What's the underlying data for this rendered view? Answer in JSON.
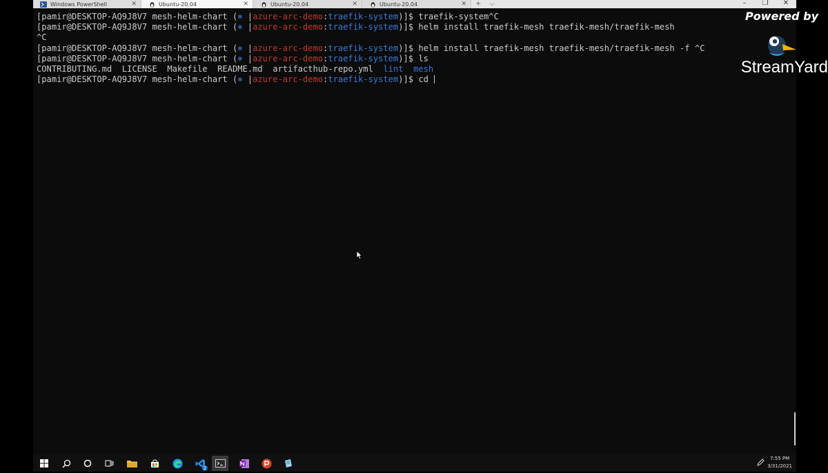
{
  "tabs": [
    {
      "label": "Windows PowerShell",
      "icon": "powershell-icon",
      "active": false
    },
    {
      "label": "Ubuntu-20.04",
      "icon": "linux-icon",
      "active": true
    },
    {
      "label": "Ubuntu-20.04",
      "icon": "linux-icon",
      "active": false
    },
    {
      "label": "Ubuntu-20.04",
      "icon": "linux-icon",
      "active": false
    }
  ],
  "tab_controls": {
    "add": "+",
    "dropdown": "⌵",
    "close": "✕"
  },
  "window_controls": {
    "minimize": "–",
    "maximize": "❐",
    "close": "✕"
  },
  "terminal": {
    "prompt": {
      "user_host": "[pamir@DESKTOP-AQ9J8V7 mesh-helm-chart (",
      "k8s_glyph": "⎈",
      "sep": " |",
      "cluster": "azure-arc-demo",
      "colon": ":",
      "namespace": "traefik-system",
      "end": ")]$ "
    },
    "lines": [
      {
        "type": "prompt",
        "cmd": "traefik-system^C"
      },
      {
        "type": "prompt",
        "cmd": "helm install traefik-mesh traefik-mesh/traefik-mesh"
      },
      {
        "type": "out",
        "text": "^C"
      },
      {
        "type": "prompt",
        "cmd": "helm install traefik-mesh traefik-mesh/traefik-mesh -f ^C"
      },
      {
        "type": "prompt",
        "cmd": "ls"
      },
      {
        "type": "ls",
        "files": [
          "CONTRIBUTING.md",
          "LICENSE",
          "Makefile",
          "README.md",
          "artifacthub-repo.yml"
        ],
        "dirs": [
          "lint",
          "mesh"
        ]
      },
      {
        "type": "prompt",
        "cmd": "cd ",
        "cursor": true
      }
    ]
  },
  "watermark": {
    "powered": "Powered by",
    "brand": "StreamYard"
  },
  "taskbar": {
    "icons": [
      {
        "name": "windows-start-icon"
      },
      {
        "name": "search-icon"
      },
      {
        "name": "cortana-icon"
      },
      {
        "name": "task-view-icon"
      },
      {
        "name": "file-explorer-icon"
      },
      {
        "name": "store-icon"
      },
      {
        "name": "edge-icon"
      },
      {
        "name": "vscode-icon",
        "badge": "2"
      },
      {
        "name": "terminal-icon",
        "active": true
      },
      {
        "name": "onenote-icon"
      },
      {
        "name": "powerpoint-icon"
      },
      {
        "name": "app-icon"
      }
    ],
    "time": "7:55 PM",
    "date": "3/31/2021"
  },
  "colors": {
    "prompt_red": "#c0392b",
    "prompt_blue": "#3b78d8",
    "text": "#cccccc",
    "background": "#0c0c0c"
  }
}
